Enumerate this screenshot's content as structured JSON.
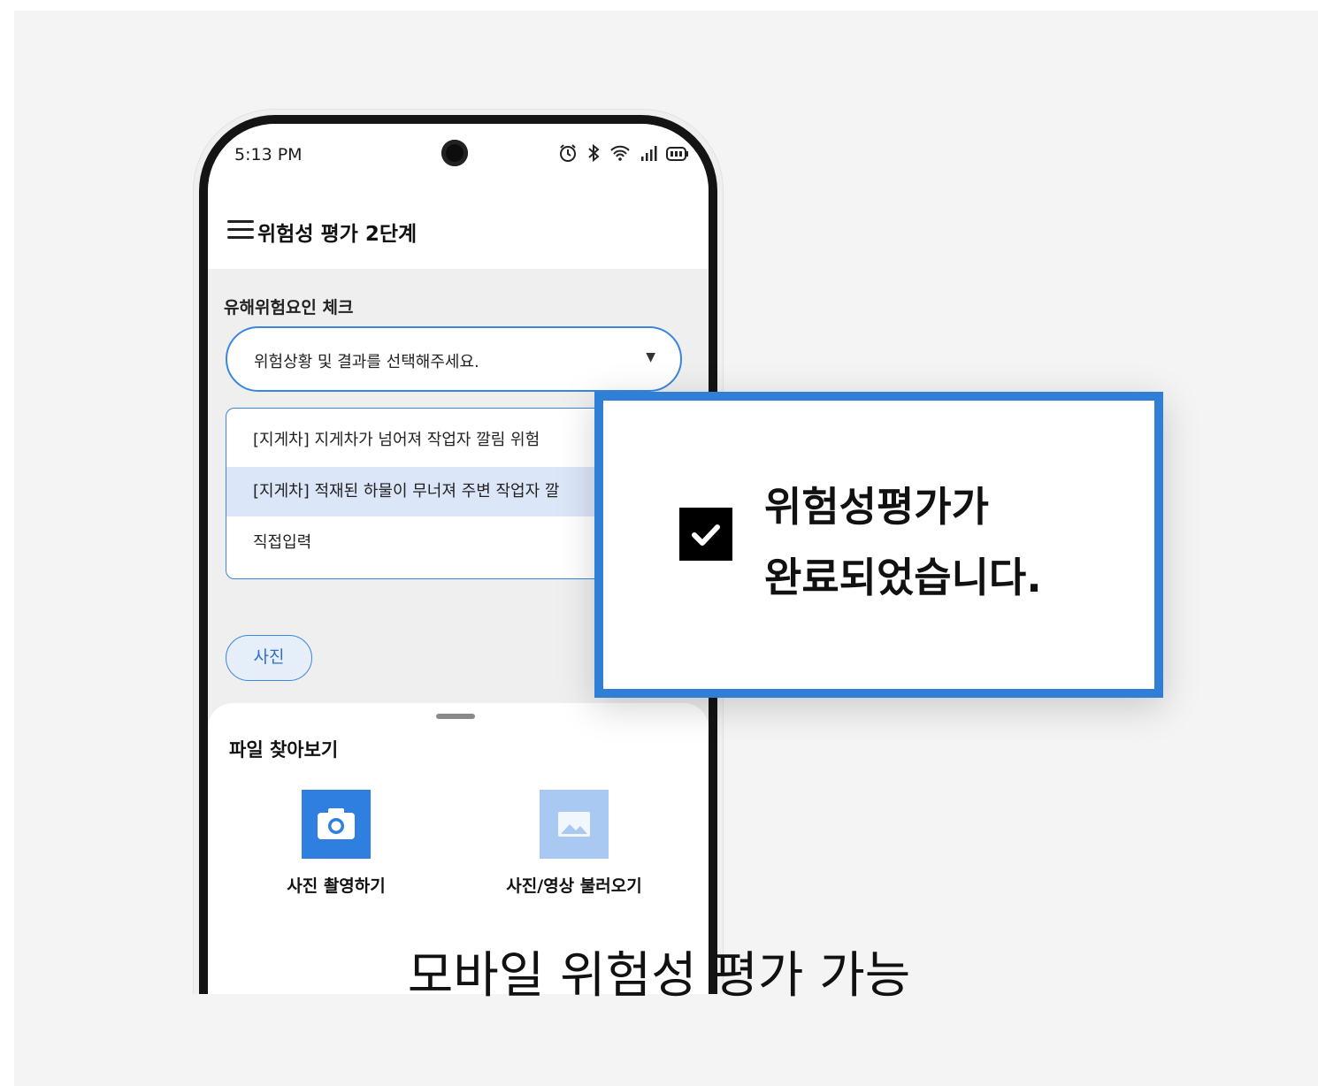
{
  "status_bar": {
    "time": "5:13 PM",
    "icons": [
      "alarm-icon",
      "bluetooth-icon",
      "wifi-icon",
      "signal-icon",
      "battery-icon"
    ]
  },
  "header": {
    "title": "위험성 평가 2단계"
  },
  "form": {
    "section_label": "유해위험요인 체크",
    "select_placeholder": "위험상황 및 결과를 선택해주세요.",
    "options": [
      "[지게차] 지게차가 넘어져 작업자 깔림 위험",
      "[지게차] 적재된 하물이 무너져 주변 작업자 깔",
      "직접입력"
    ],
    "selected_index": 1,
    "photo_chip": "사진"
  },
  "sheet": {
    "title": "파일 찾아보기",
    "options": [
      {
        "label": "사진 촬영하기",
        "icon": "camera-icon"
      },
      {
        "label": "사진/영상 불러오기",
        "icon": "image-icon"
      }
    ]
  },
  "dialog": {
    "line1": "위험성평가가",
    "line2": "완료되었습니다."
  },
  "caption": "모바일 위험성 평가 가능",
  "colors": {
    "accent": "#2f7fd6",
    "selected_bg": "#dbe6f9",
    "camera_tile": "#2f7fe0",
    "image_tile": "#a9c8f2"
  }
}
